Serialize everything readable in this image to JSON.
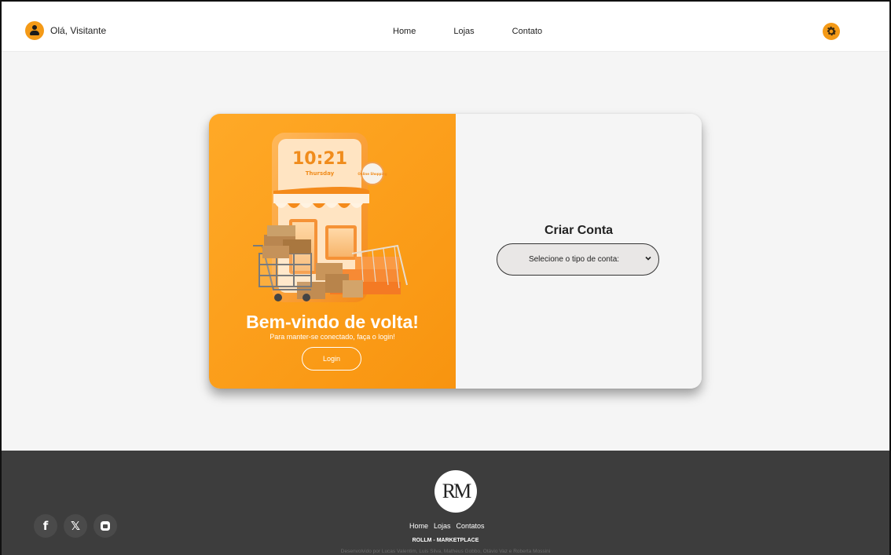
{
  "header": {
    "greeting": "Olá, Visitante",
    "nav": [
      "Home",
      "Lojas",
      "Contato"
    ]
  },
  "welcome_panel": {
    "title": "Bem-vindo de volta!",
    "subtitle": "Para manter-se conectado, faça o login!",
    "login_label": "Login",
    "illustration": {
      "clock": "10:21",
      "day": "Thursday",
      "sign": "Online Shopping"
    }
  },
  "signup_panel": {
    "title": "Criar Conta",
    "account_type_selected": "Selecione o tipo de conta:"
  },
  "footer": {
    "logo_text": "RM",
    "links": [
      "Home",
      "Lojas",
      "Contatos"
    ],
    "brand": "ROLLM - MARKETPLACE",
    "credits": "Desenvolvido por Lucas Valentim, Luis Silva, Matheus Gobbo, Otávio Vaz e Roberta Mossini",
    "socials": [
      {
        "name": "facebook-icon",
        "glyph": "f"
      },
      {
        "name": "x-twitter-icon",
        "glyph": "𝕏"
      },
      {
        "name": "instagram-icon",
        "glyph": ""
      }
    ]
  },
  "colors": {
    "accent": "#f49a17",
    "footer_bg": "#3d3d3d",
    "page_bg": "#f5f5f5"
  }
}
